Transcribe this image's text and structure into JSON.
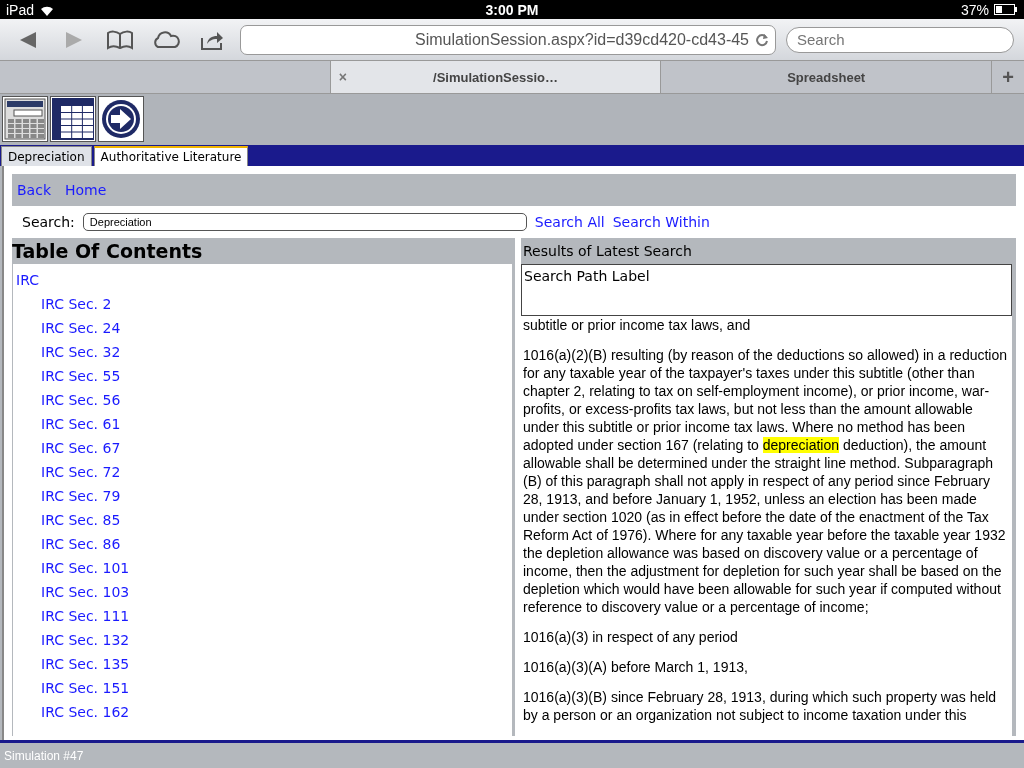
{
  "status_bar": {
    "device": "iPad",
    "time": "3:00 PM",
    "battery": "37%"
  },
  "browser": {
    "url": "SimulationSession.aspx?id=d39cd420-cd43-45",
    "search_placeholder": "Search",
    "tabs": [
      {
        "selected": false
      },
      {
        "title": "/SimulationSessio…",
        "close": "×",
        "selected": true
      },
      {
        "title": "Spreadsheet",
        "selected": false
      }
    ],
    "new_tab": "+"
  },
  "app_tabs": [
    {
      "label": "Depreciation",
      "selected": false
    },
    {
      "label": "Authoritative Literature",
      "selected": true
    }
  ],
  "nav_links": [
    "Back",
    "Home"
  ],
  "search": {
    "label": "Search:",
    "value": "Depreciation",
    "buttons": [
      "Search All",
      "Search Within"
    ]
  },
  "toc": {
    "title": "Table Of Contents",
    "items": [
      {
        "label": "IRC",
        "children": [
          {
            "label": "IRC Sec. 2"
          },
          {
            "label": "IRC Sec. 24"
          },
          {
            "label": "IRC Sec. 32"
          },
          {
            "label": "IRC Sec. 55"
          },
          {
            "label": "IRC Sec. 56"
          },
          {
            "label": "IRC Sec. 61"
          },
          {
            "label": "IRC Sec. 67"
          },
          {
            "label": "IRC Sec. 72"
          },
          {
            "label": "IRC Sec. 79"
          },
          {
            "label": "IRC Sec. 85"
          },
          {
            "label": "IRC Sec. 86"
          },
          {
            "label": "IRC Sec. 101"
          },
          {
            "label": "IRC Sec. 103"
          },
          {
            "label": "IRC Sec. 111"
          },
          {
            "label": "IRC Sec. 132"
          },
          {
            "label": "IRC Sec. 135"
          },
          {
            "label": "IRC Sec. 151"
          },
          {
            "label": "IRC Sec. 162"
          }
        ]
      }
    ]
  },
  "results": {
    "title": "Results of Latest Search",
    "path_label": "Search Path Label",
    "paragraphs": [
      [
        {
          "text": "subtitle or prior income tax laws, and",
          "highlighted": false
        }
      ],
      [
        {
          "text": "1016(a)(2)(B) resulting (by reason of the deductions so allowed) in a reduction for any taxable year of the taxpayer's taxes under this subtitle (other than chapter 2, relating to tax on self-employment income), or prior income, war-profits, or excess-profits tax laws, but not less than the amount allowable under this subtitle or prior income tax laws. Where no method has been adopted under section 167 (relating to ",
          "highlighted": false
        },
        {
          "text": "depreciation",
          "highlighted": true
        },
        {
          "text": " deduction), the amount allowable shall be determined under the straight line method. Subparagraph (B) of this paragraph shall not apply in respect of any period since February 28, 1913, and before January 1, 1952, unless an election has been made under section 1020 (as in effect before the date of the enactment of the Tax Reform Act of 1976). Where for any taxable year before the taxable year 1932 the depletion allowance was based on discovery value or a percentage of income, then the adjustment for depletion for such year shall be based on the depletion which would have been allowable for such year if computed without reference to discovery value or a percentage of income;",
          "highlighted": false
        }
      ],
      [
        {
          "text": "1016(a)(3) in respect of any period",
          "highlighted": false
        }
      ],
      [
        {
          "text": "1016(a)(3)(A) before March 1, 1913,",
          "highlighted": false
        }
      ],
      [
        {
          "text": "1016(a)(3)(B) since February 28, 1913, during which such property was held by a person or an organization not subject to income taxation under this",
          "highlighted": false
        }
      ]
    ]
  },
  "footer": "Simulation #47"
}
